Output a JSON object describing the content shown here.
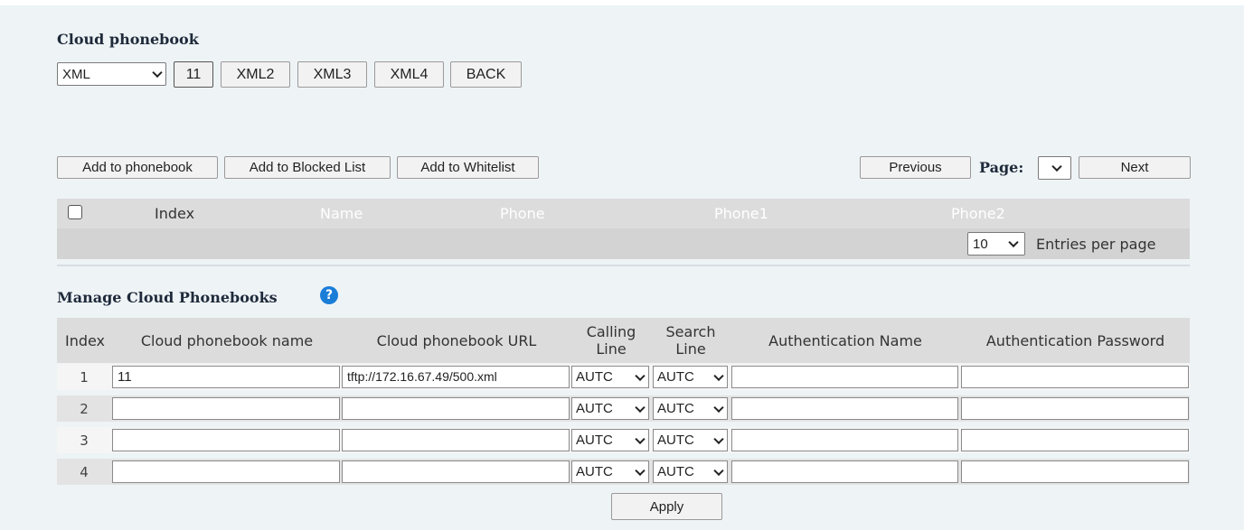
{
  "cloud_phonebook": {
    "title": "Cloud phonebook",
    "selector_value": "XML",
    "buttons": [
      "11",
      "XML2",
      "XML3",
      "XML4",
      "BACK"
    ]
  },
  "actions": {
    "add_phonebook": "Add to phonebook",
    "add_blocked": "Add to Blocked List",
    "add_whitelist": "Add to Whitelist",
    "previous": "Previous",
    "page_label": "Page:",
    "page_value": "",
    "next": "Next"
  },
  "contacts_table": {
    "headers": [
      "Index",
      "Name",
      "Phone",
      "Phone1",
      "Phone2"
    ],
    "entries_value": "10",
    "entries_label": "Entries per page"
  },
  "manage": {
    "title": "Manage Cloud Phonebooks",
    "help_icon": "question-circle-icon",
    "headers": {
      "index": "Index",
      "name": "Cloud phonebook name",
      "url": "Cloud phonebook URL",
      "calling_line_1": "Calling",
      "calling_line_2": "Line",
      "search_line_1": "Search",
      "search_line_2": "Line",
      "auth_name": "Authentication Name",
      "auth_password": "Authentication Password"
    },
    "rows": [
      {
        "index": "1",
        "name": "11",
        "url": "tftp://172.16.67.49/500.xml",
        "calling": "AUTC",
        "search": "AUTC",
        "auth_name": "",
        "auth_password": ""
      },
      {
        "index": "2",
        "name": "",
        "url": "",
        "calling": "AUTC",
        "search": "AUTC",
        "auth_name": "",
        "auth_password": ""
      },
      {
        "index": "3",
        "name": "",
        "url": "",
        "calling": "AUTC",
        "search": "AUTC",
        "auth_name": "",
        "auth_password": ""
      },
      {
        "index": "4",
        "name": "",
        "url": "",
        "calling": "AUTC",
        "search": "AUTC",
        "auth_name": "",
        "auth_password": ""
      }
    ],
    "apply": "Apply"
  },
  "colors": {
    "panel_bg": "#eef3f6",
    "header_bg": "#dcdcdc",
    "help_icon": "#1a7dd8"
  }
}
